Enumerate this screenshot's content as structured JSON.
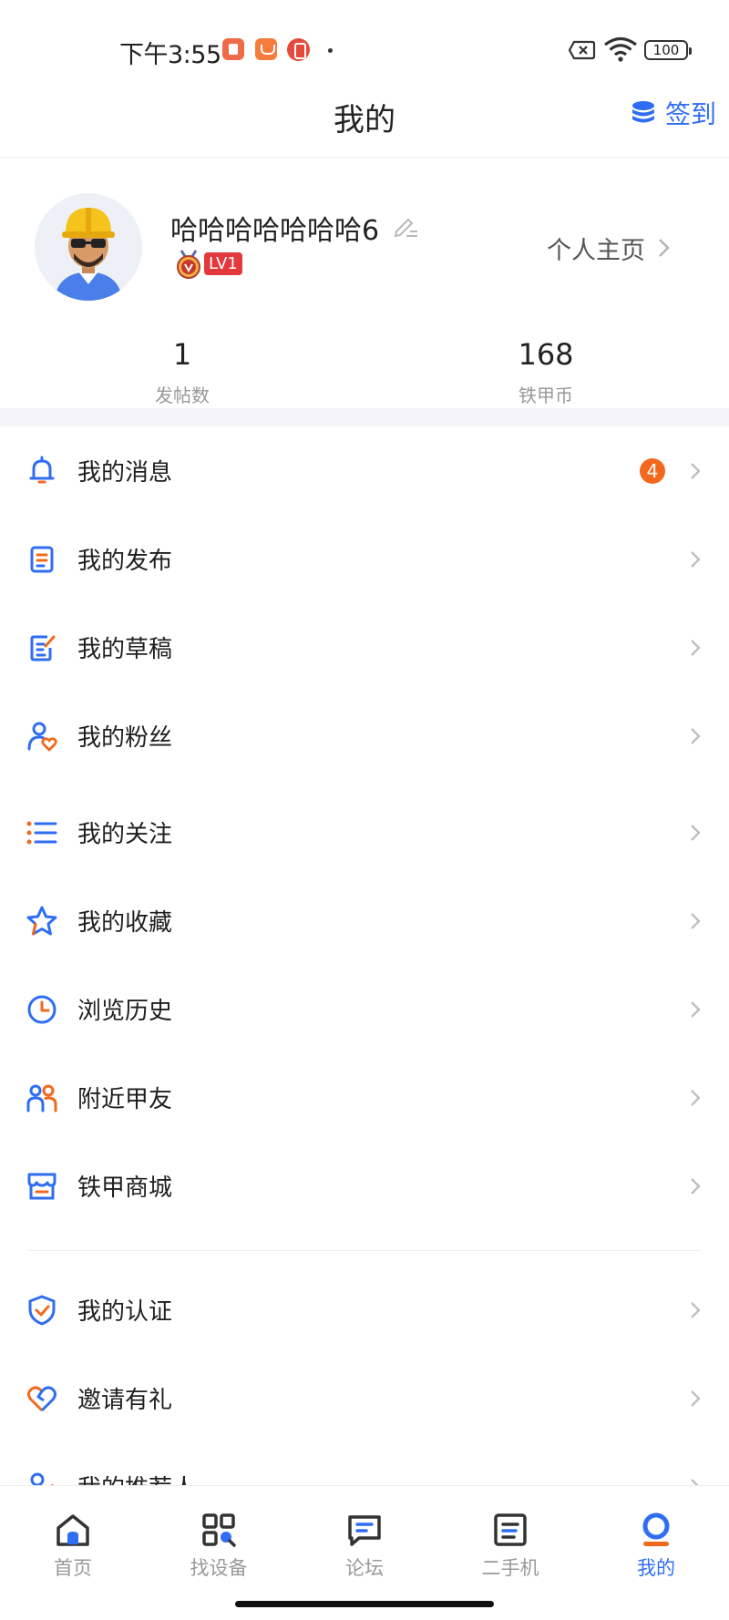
{
  "status_bar": {
    "time": "下午3:55",
    "battery": "100"
  },
  "header": {
    "title": "我的",
    "checkin_label": "签到"
  },
  "profile": {
    "username": "哈哈哈哈哈哈哈6",
    "level": "LV1",
    "homepage_label": "个人主页"
  },
  "stats": {
    "posts_value": "1",
    "posts_label": "发帖数",
    "coins_value": "168",
    "coins_label": "铁甲币"
  },
  "menu": {
    "items": [
      {
        "label": "我的消息",
        "icon": "bell-icon",
        "badge": "4"
      },
      {
        "label": "我的发布",
        "icon": "document-icon"
      },
      {
        "label": "我的草稿",
        "icon": "draft-edit-icon"
      },
      {
        "label": "我的粉丝",
        "icon": "fans-heart-icon"
      },
      {
        "label": "我的关注",
        "icon": "follow-list-icon"
      },
      {
        "label": "我的收藏",
        "icon": "star-icon"
      },
      {
        "label": "浏览历史",
        "icon": "clock-icon"
      },
      {
        "label": "附近甲友",
        "icon": "people-nearby-icon"
      },
      {
        "label": "铁甲商城",
        "icon": "store-icon"
      },
      {
        "label": "我的认证",
        "icon": "shield-check-icon"
      },
      {
        "label": "邀请有礼",
        "icon": "heart-gift-icon"
      },
      {
        "label": "我的推荐人",
        "icon": "referrer-icon"
      }
    ]
  },
  "tabs": [
    {
      "label": "首页",
      "icon": "home-icon"
    },
    {
      "label": "找设备",
      "icon": "grid-search-icon"
    },
    {
      "label": "论坛",
      "icon": "chat-bubble-icon"
    },
    {
      "label": "二手机",
      "icon": "card-list-icon"
    },
    {
      "label": "我的",
      "icon": "profile-icon",
      "active": true
    }
  ],
  "colors": {
    "accent": "#2f6ef2",
    "accent_orange": "#f2691e",
    "level_badge": "#e3393c"
  }
}
